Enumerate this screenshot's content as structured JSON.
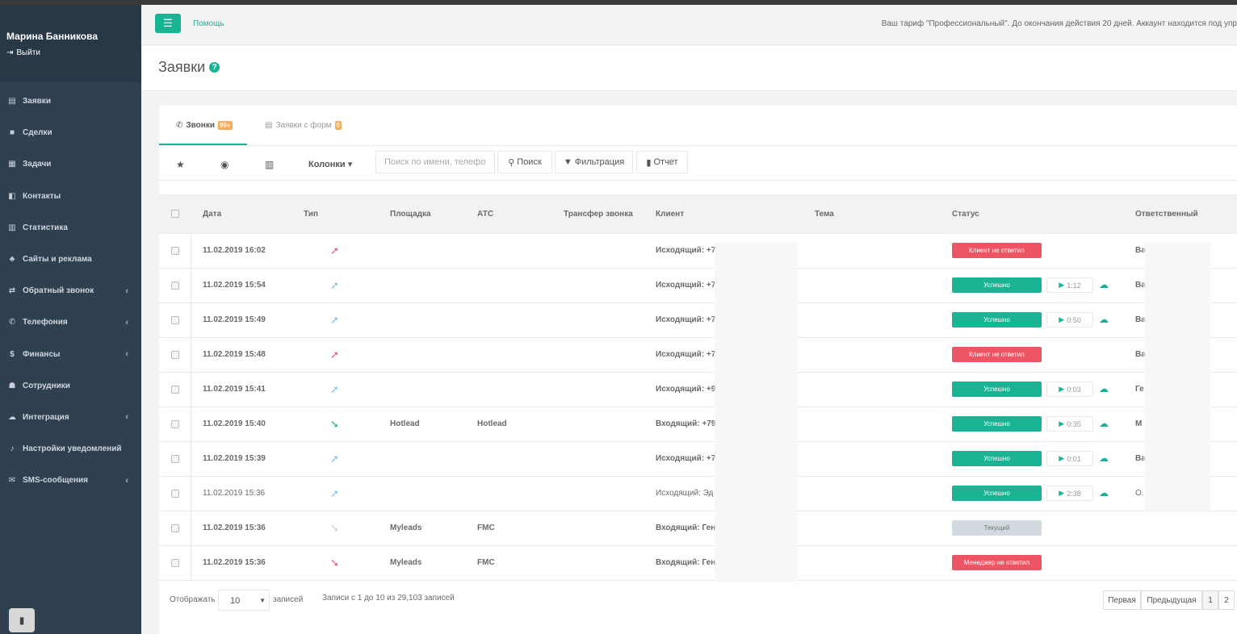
{
  "sidebar": {
    "user_name": "Марина Банникова",
    "logout_label": "Выйти",
    "items": [
      {
        "label": "Заявки",
        "icon": "id-card-icon",
        "glyph": "▤",
        "has_arrow": false
      },
      {
        "label": "Сделки",
        "icon": "briefcase-icon",
        "glyph": "■",
        "has_arrow": false
      },
      {
        "label": "Задачи",
        "icon": "calendar-icon",
        "glyph": "▦",
        "has_arrow": false
      },
      {
        "label": "Контакты",
        "icon": "contacts-icon",
        "glyph": "◧",
        "has_arrow": false
      },
      {
        "label": "Статистика",
        "icon": "bar-chart-icon",
        "glyph": "▥",
        "has_arrow": false
      },
      {
        "label": "Сайты и реклама",
        "icon": "sitemap-icon",
        "glyph": "♣",
        "has_arrow": false
      },
      {
        "label": "Обратный звонок",
        "icon": "exchange-icon",
        "glyph": "⇄",
        "has_arrow": true
      },
      {
        "label": "Телефония",
        "icon": "phone-icon",
        "glyph": "✆",
        "has_arrow": true
      },
      {
        "label": "Финансы",
        "icon": "dollar-icon",
        "glyph": "$",
        "has_arrow": true
      },
      {
        "label": "Сотрудники",
        "icon": "users-icon",
        "glyph": "☗",
        "has_arrow": false
      },
      {
        "label": "Интеграция",
        "icon": "cloud-icon",
        "glyph": "☁",
        "has_arrow": true
      },
      {
        "label": "Настройки уведомлений",
        "icon": "bell-icon",
        "glyph": "♪",
        "has_arrow": false
      },
      {
        "label": "SMS-сообщения",
        "icon": "envelope-icon",
        "glyph": "✉",
        "has_arrow": true
      }
    ]
  },
  "topbar": {
    "help": "Помощь",
    "tariff": "Ваш тариф \"Профессиональный\". До окончания действия 20 дней. Аккаунт находится под упр"
  },
  "page": {
    "title": "Заявки"
  },
  "tabs": [
    {
      "label": "Звонки",
      "badge": "99+",
      "active": true
    },
    {
      "label": "Заявки с форм",
      "badge": "0",
      "active": false
    }
  ],
  "toolbar": {
    "columns": "Колонки",
    "search_placeholder": "Поиск по имени, телефону",
    "search_btn": "Поиск",
    "filter_btn": "Фильтрация",
    "report_btn": "Отчет"
  },
  "table": {
    "headers": [
      "Дата",
      "Тип",
      "Площадка",
      "АТС",
      "Трансфер звонка",
      "Клиент",
      "Тема",
      "Статус",
      "Ответственный"
    ],
    "rows": [
      {
        "date": "11.02.2019 16:02",
        "dir": "out",
        "color": "#ed5565",
        "site": "",
        "ats": "",
        "client": "Исходящий: +7",
        "status": "Клиент не ответил",
        "status_color": "#ed5565",
        "rec": "",
        "resp": "Ва",
        "bold": true
      },
      {
        "date": "11.02.2019 15:54",
        "dir": "out",
        "color": "#7fc1ea",
        "site": "",
        "ats": "",
        "client": "Исходящий: +7",
        "status": "Успешно",
        "status_color": "#1ab394",
        "rec": "1:12",
        "resp": "Ва",
        "bold": true
      },
      {
        "date": "11.02.2019 15:49",
        "dir": "out",
        "color": "#7fc1ea",
        "site": "",
        "ats": "",
        "client": "Исходящий: +7",
        "status": "Успешно",
        "status_color": "#1ab394",
        "rec": "0:50",
        "resp": "Ва",
        "bold": true
      },
      {
        "date": "11.02.2019 15:48",
        "dir": "out",
        "color": "#ed5565",
        "site": "",
        "ats": "",
        "client": "Исходящий: +7",
        "status": "Клиент не ответил",
        "status_color": "#ed5565",
        "rec": "",
        "resp": "Ва",
        "bold": true
      },
      {
        "date": "11.02.2019 15:41",
        "dir": "out",
        "color": "#7fc1ea",
        "site": "",
        "ats": "",
        "client": "Исходящий: +9",
        "status": "Успешно",
        "status_color": "#1ab394",
        "rec": "0:03",
        "resp": "Ге",
        "bold": true
      },
      {
        "date": "11.02.2019 15:40",
        "dir": "in",
        "color": "#1ab394",
        "site": "Hotlead",
        "ats": "Hotlead",
        "client": "Входящий: +79",
        "status": "Успешно",
        "status_color": "#1ab394",
        "rec": "0:35",
        "resp": "М",
        "bold": true
      },
      {
        "date": "11.02.2019 15:39",
        "dir": "out",
        "color": "#7fc1ea",
        "site": "",
        "ats": "",
        "client": "Исходящий: +7",
        "status": "Успешно",
        "status_color": "#1ab394",
        "rec": "0:01",
        "resp": "Ва",
        "bold": true
      },
      {
        "date": "11.02.2019 15:36",
        "dir": "out",
        "color": "#7fc1ea",
        "site": "",
        "ats": "",
        "client": "Исходящий: Эд",
        "status": "Успешно",
        "status_color": "#1ab394",
        "rec": "2:38",
        "resp": "О.",
        "bold": false
      },
      {
        "date": "11.02.2019 15:36",
        "dir": "in",
        "color": "#c8d1d3",
        "site": "Myleads",
        "ats": "FMC",
        "client": "Входящий: Ген",
        "status": "Текущий",
        "status_color": "#d1dade",
        "rec": "",
        "resp": "",
        "bold": true
      },
      {
        "date": "11.02.2019 15:36",
        "dir": "in",
        "color": "#ed5565",
        "site": "Myleads",
        "ats": "FMC",
        "client": "Входящий: Ген",
        "status": "Менеджер не ответил",
        "status_color": "#ed5565",
        "rec": "",
        "resp": "",
        "bold": true
      }
    ]
  },
  "footer": {
    "show_label": "Отображать",
    "page_size": "10",
    "records_label": "записей",
    "info": "Записи с 1 до 10 из 29,103 записей",
    "first": "Первая",
    "prev": "Предыдущая",
    "pages": [
      "1",
      "2"
    ]
  }
}
